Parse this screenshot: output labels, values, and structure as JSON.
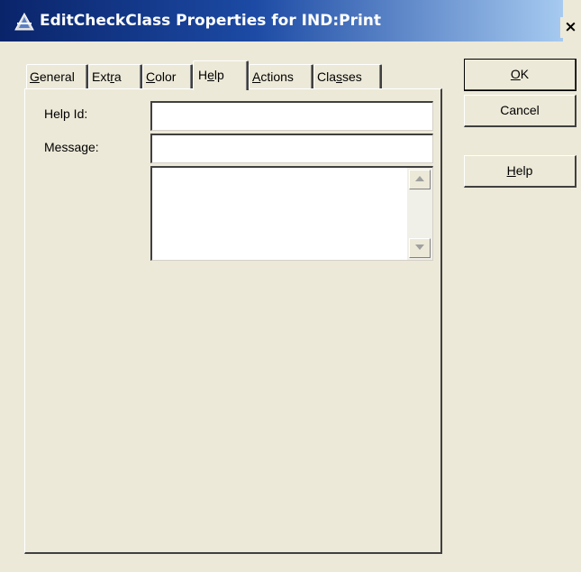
{
  "window": {
    "title": "EditCheckClass Properties for IND:Print",
    "close_glyph": "×"
  },
  "tabs": [
    {
      "label": "General",
      "mnemonic_index": 0
    },
    {
      "label": "Extra",
      "mnemonic_index": 3
    },
    {
      "label": "Color",
      "mnemonic_index": 0
    },
    {
      "label": "Help",
      "mnemonic_index": 1,
      "active": true
    },
    {
      "label": "Actions",
      "mnemonic_index": 0
    },
    {
      "label": "Classes",
      "mnemonic_index": 3
    }
  ],
  "help_panel": {
    "help_id_label": "Help Id:",
    "help_id_value": "",
    "message_label": "Message:",
    "message_value": "",
    "message_text": ""
  },
  "buttons": {
    "ok": "OK",
    "cancel": "Cancel",
    "help": "Help"
  },
  "icons": {
    "title": "app-icon",
    "scroll_up": "triangle-up-icon",
    "scroll_down": "triangle-down-icon"
  },
  "colors": {
    "titlebar_start": "#0a246a",
    "titlebar_end": "#a6caf0",
    "face": "#ece9d8"
  }
}
